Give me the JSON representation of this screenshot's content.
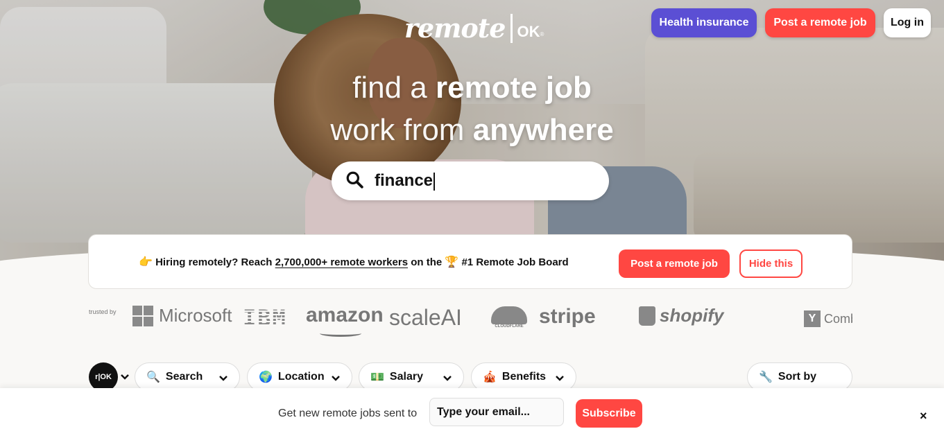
{
  "header": {
    "logo_word": "remote",
    "logo_ok": "OK",
    "logo_reg": "®",
    "buttons": {
      "health": "Health insurance",
      "post": "Post a remote job",
      "login": "Log in"
    }
  },
  "hero": {
    "line1_thin": "find a",
    "line1_bold": "remote job",
    "line2_thin": "work from",
    "line2_bold": "anywhere",
    "search_value": "finance"
  },
  "hiring": {
    "emoji_point": "👉",
    "text_before": "Hiring remotely? Reach",
    "link_text": "2,700,000+ remote workers",
    "text_mid": "on the",
    "emoji_trophy": "🏆",
    "text_after": "#1 Remote Job Board",
    "post_button": "Post a remote job",
    "hide_button": "Hide this"
  },
  "trusted": {
    "label": "trusted by",
    "brands": {
      "microsoft": "Microsoft",
      "ibm": "IBM",
      "amazon": "amazon",
      "scale": "scaleAI",
      "cloudflare": "CLOUDFLARE",
      "stripe": "stripe",
      "shopify": "shopify",
      "yc": "Y",
      "yc_text": "Comb"
    }
  },
  "filters": {
    "rok": "r|OK",
    "items": [
      {
        "icon": "🔍",
        "label": "Search"
      },
      {
        "icon": "🌍",
        "label": "Location"
      },
      {
        "icon": "💵",
        "label": "Salary"
      },
      {
        "icon": "🎪",
        "label": "Benefits"
      }
    ],
    "sort": {
      "icon": "🔧",
      "label": "Sort by"
    }
  },
  "subscribe_bar": {
    "label": "Get new remote jobs sent to",
    "email_placeholder": "Type your email...",
    "button": "Subscribe",
    "close": "×"
  },
  "colors": {
    "accent_red": "#ff4742",
    "accent_purple": "#5b4fd4"
  }
}
